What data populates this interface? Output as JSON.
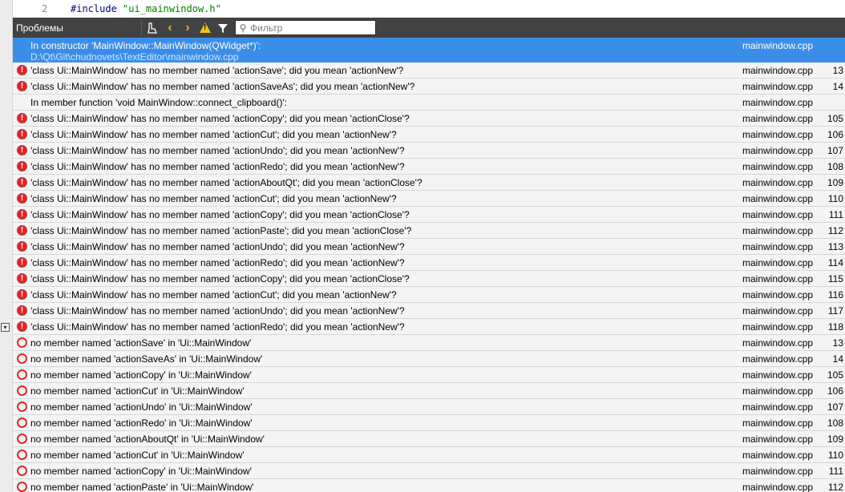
{
  "editor": {
    "line_number": "2",
    "code_keyword": "#include",
    "code_string": "\"ui_mainwindow.h\""
  },
  "toolbar": {
    "title": "Проблемы",
    "filter_placeholder": "Фильтр"
  },
  "issues": [
    {
      "type": "info",
      "selected": true,
      "text": "In constructor 'MainWindow::MainWindow(QWidget*)':",
      "path": "D:\\Qt\\Git\\chudnovets\\TextEditor\\mainwindow.cpp",
      "file": "mainwindow.cpp",
      "line": ""
    },
    {
      "type": "error",
      "text": "'class Ui::MainWindow' has no member named 'actionSave'; did you mean 'actionNew'?",
      "file": "mainwindow.cpp",
      "line": "13"
    },
    {
      "type": "error",
      "text": "'class Ui::MainWindow' has no member named 'actionSaveAs'; did you mean 'actionNew'?",
      "file": "mainwindow.cpp",
      "line": "14"
    },
    {
      "type": "info",
      "text": "In member function 'void MainWindow::connect_clipboard()':",
      "file": "mainwindow.cpp",
      "line": ""
    },
    {
      "type": "error",
      "text": "'class Ui::MainWindow' has no member named 'actionCopy'; did you mean 'actionClose'?",
      "file": "mainwindow.cpp",
      "line": "105"
    },
    {
      "type": "error",
      "text": "'class Ui::MainWindow' has no member named 'actionCut'; did you mean 'actionNew'?",
      "file": "mainwindow.cpp",
      "line": "106"
    },
    {
      "type": "error",
      "text": "'class Ui::MainWindow' has no member named 'actionUndo'; did you mean 'actionNew'?",
      "file": "mainwindow.cpp",
      "line": "107"
    },
    {
      "type": "error",
      "text": "'class Ui::MainWindow' has no member named 'actionRedo'; did you mean 'actionNew'?",
      "file": "mainwindow.cpp",
      "line": "108"
    },
    {
      "type": "error",
      "text": "'class Ui::MainWindow' has no member named 'actionAboutQt'; did you mean 'actionClose'?",
      "file": "mainwindow.cpp",
      "line": "109"
    },
    {
      "type": "error",
      "text": "'class Ui::MainWindow' has no member named 'actionCut'; did you mean 'actionNew'?",
      "file": "mainwindow.cpp",
      "line": "110"
    },
    {
      "type": "error",
      "text": "'class Ui::MainWindow' has no member named 'actionCopy'; did you mean 'actionClose'?",
      "file": "mainwindow.cpp",
      "line": "111"
    },
    {
      "type": "error",
      "text": "'class Ui::MainWindow' has no member named 'actionPaste'; did you mean 'actionClose'?",
      "file": "mainwindow.cpp",
      "line": "112"
    },
    {
      "type": "error",
      "text": "'class Ui::MainWindow' has no member named 'actionUndo'; did you mean 'actionNew'?",
      "file": "mainwindow.cpp",
      "line": "113"
    },
    {
      "type": "error",
      "text": "'class Ui::MainWindow' has no member named 'actionRedo'; did you mean 'actionNew'?",
      "file": "mainwindow.cpp",
      "line": "114"
    },
    {
      "type": "error",
      "text": "'class Ui::MainWindow' has no member named 'actionCopy'; did you mean 'actionClose'?",
      "file": "mainwindow.cpp",
      "line": "115"
    },
    {
      "type": "error",
      "text": "'class Ui::MainWindow' has no member named 'actionCut'; did you mean 'actionNew'?",
      "file": "mainwindow.cpp",
      "line": "116"
    },
    {
      "type": "error",
      "text": "'class Ui::MainWindow' has no member named 'actionUndo'; did you mean 'actionNew'?",
      "file": "mainwindow.cpp",
      "line": "117"
    },
    {
      "type": "error",
      "text": "'class Ui::MainWindow' has no member named 'actionRedo'; did you mean 'actionNew'?",
      "file": "mainwindow.cpp",
      "line": "118"
    },
    {
      "type": "warning",
      "text": "no member named 'actionSave' in 'Ui::MainWindow'",
      "file": "mainwindow.cpp",
      "line": "13"
    },
    {
      "type": "warning",
      "text": "no member named 'actionSaveAs' in 'Ui::MainWindow'",
      "file": "mainwindow.cpp",
      "line": "14"
    },
    {
      "type": "warning",
      "text": "no member named 'actionCopy' in 'Ui::MainWindow'",
      "file": "mainwindow.cpp",
      "line": "105"
    },
    {
      "type": "warning",
      "text": "no member named 'actionCut' in 'Ui::MainWindow'",
      "file": "mainwindow.cpp",
      "line": "106"
    },
    {
      "type": "warning",
      "text": "no member named 'actionUndo' in 'Ui::MainWindow'",
      "file": "mainwindow.cpp",
      "line": "107"
    },
    {
      "type": "warning",
      "text": "no member named 'actionRedo' in 'Ui::MainWindow'",
      "file": "mainwindow.cpp",
      "line": "108"
    },
    {
      "type": "warning",
      "text": "no member named 'actionAboutQt' in 'Ui::MainWindow'",
      "file": "mainwindow.cpp",
      "line": "109"
    },
    {
      "type": "warning",
      "text": "no member named 'actionCut' in 'Ui::MainWindow'",
      "file": "mainwindow.cpp",
      "line": "110"
    },
    {
      "type": "warning",
      "text": "no member named 'actionCopy' in 'Ui::MainWindow'",
      "file": "mainwindow.cpp",
      "line": "111"
    },
    {
      "type": "warning",
      "text": "no member named 'actionPaste' in 'Ui::MainWindow'",
      "file": "mainwindow.cpp",
      "line": "112"
    }
  ],
  "colors": {
    "toolbar_bg": "#404244",
    "selection": "#3b8ee8",
    "error": "#d62b2b",
    "warning_tri": "#f0c419",
    "nav_arrow": "#f0b429"
  }
}
